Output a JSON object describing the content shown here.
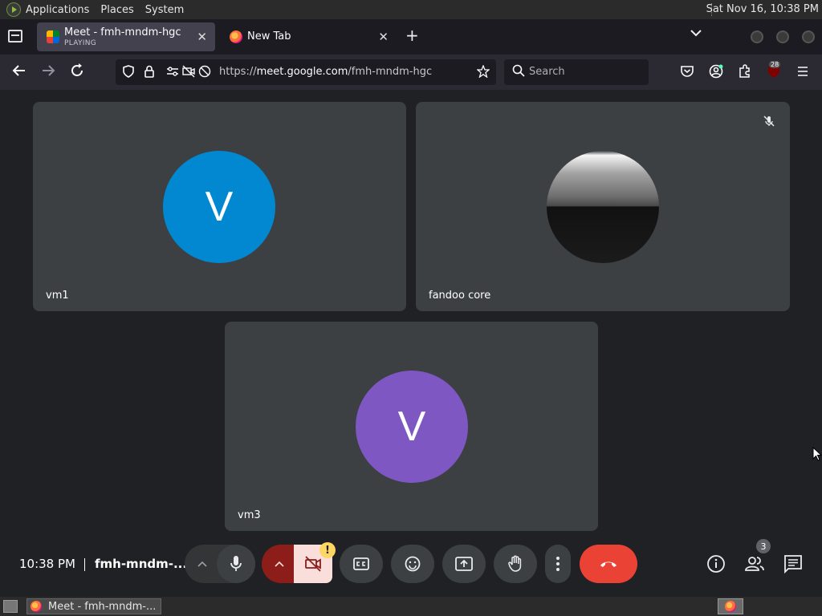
{
  "system_panel": {
    "menus": [
      "Applications",
      "Places",
      "System"
    ],
    "clock": "Sat Nov 16, 10:38 PM"
  },
  "browser": {
    "tabs": [
      {
        "title": "Meet - fmh-mndm-hgc",
        "subtitle": "PLAYING",
        "favicon": "google-meet-icon",
        "active": true
      },
      {
        "title": "New Tab",
        "favicon": "firefox-icon",
        "active": false
      }
    ],
    "url_prefix": "https://",
    "url_host": "meet.google.com",
    "url_path": "/fmh-mndm-hgc",
    "search_placeholder": "Search",
    "extension_badge": "28"
  },
  "meet": {
    "participants": [
      {
        "name": "vm1",
        "initial": "V",
        "avatar_color": "#0288d1",
        "muted": false,
        "has_photo": false
      },
      {
        "name": "fandoo core",
        "initial": "",
        "avatar_color": "",
        "muted": true,
        "has_photo": true
      },
      {
        "name": "vm3",
        "initial": "V",
        "avatar_color": "#7e57c2",
        "muted": false,
        "has_photo": false
      }
    ],
    "time": "10:38 PM",
    "meeting_code": "fmh-mndm-...",
    "camera_warning": "!",
    "people_count": "3"
  },
  "taskbar": {
    "window_title": "Meet - fmh-mndm-..."
  }
}
